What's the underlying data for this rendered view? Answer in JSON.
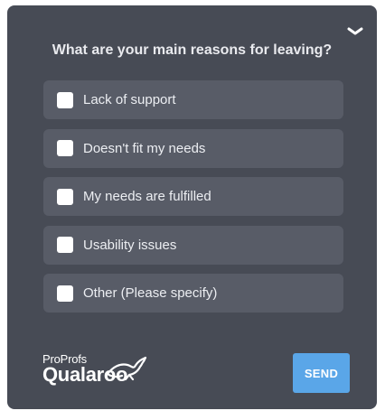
{
  "survey": {
    "question": "What are your main reasons for leaving?",
    "collapse_icon": "chevron-down-icon",
    "options": [
      {
        "label": "Lack of support",
        "checked": false
      },
      {
        "label": "Doesn't fit my needs",
        "checked": false
      },
      {
        "label": "My needs are fulfilled",
        "checked": false
      },
      {
        "label": "Usability issues",
        "checked": false
      },
      {
        "label": "Other (Please specify)",
        "checked": false
      }
    ],
    "send_label": "SEND"
  },
  "brand": {
    "top": "ProProfs",
    "main": "Qualaroo",
    "icon": "kangaroo-icon"
  },
  "colors": {
    "panel": "#474b55",
    "option": "#585c67",
    "send": "#5aa6e8"
  }
}
